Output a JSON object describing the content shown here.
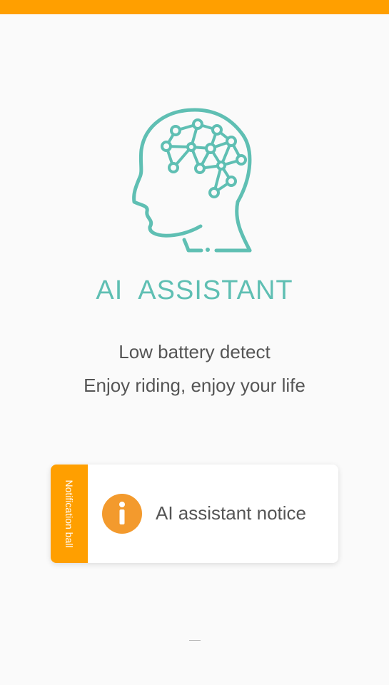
{
  "colors": {
    "accent_orange": "#ff9f00",
    "teal": "#5fbfb3",
    "info_orange": "#f39a2d",
    "text_gray": "#555555",
    "background": "#fafafa"
  },
  "hero": {
    "icon": "head-brain-network-icon",
    "title": "AI  ASSISTANT"
  },
  "feature_lines": {
    "line1": "Low battery detect",
    "line2": "Enjoy riding, enjoy your life"
  },
  "notice_card": {
    "tab_label": "Notification ball",
    "icon": "info-icon",
    "label": "AI assistant notice"
  }
}
